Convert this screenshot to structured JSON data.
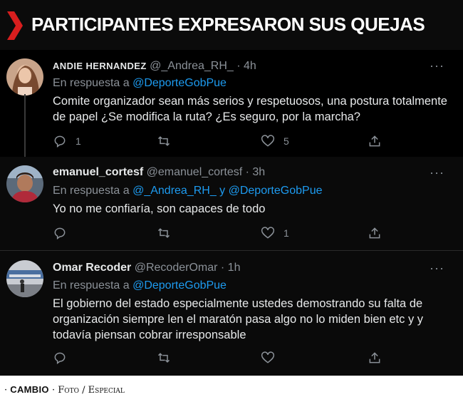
{
  "banner": {
    "title": "PARTICIPANTES EXPRESARON SUS QUEJAS",
    "accent": "#d81e1e"
  },
  "tweets": [
    {
      "name": "ANDIE HERNANDEZ",
      "handle": "@_Andrea_RH_",
      "time": "· 4h",
      "reply_prefix": "En respuesta a",
      "reply_to": "@DeporteGobPue",
      "text": "Comite organizador sean más serios y respetuosos, una postura totalmente de papel ¿Se modifica la ruta? ¿Es seguro, por la marcha?",
      "replies": "1",
      "retweets": "",
      "likes": "5"
    },
    {
      "name": "emanuel_cortesf",
      "handle": "@emanuel_cortesf",
      "time": "· 3h",
      "reply_prefix": "En respuesta a",
      "reply_to": "@_Andrea_RH_ y @DeporteGobPue",
      "text": "Yo no me confiaría, son capaces de todo",
      "replies": "",
      "retweets": "",
      "likes": "1"
    },
    {
      "name": "Omar Recoder",
      "handle": "@RecoderOmar",
      "time": "· 1h",
      "reply_prefix": "En respuesta a",
      "reply_to": "@DeporteGobPue",
      "text": "El gobierno del estado especialmente ustedes demostrando su falta de organización siempre len el maratón pasa algo no lo miden bien etc y y todavía piensan cobrar irresponsable",
      "replies": "",
      "retweets": "",
      "likes": ""
    }
  ],
  "icons": {
    "reply": "reply-icon",
    "retweet": "retweet-icon",
    "like": "like-icon",
    "share": "share-icon",
    "more": "more-icon"
  },
  "footer": {
    "bullet": "·",
    "brand": "CAMBIO",
    "sep": "·",
    "credit": "Foto / Especial"
  }
}
